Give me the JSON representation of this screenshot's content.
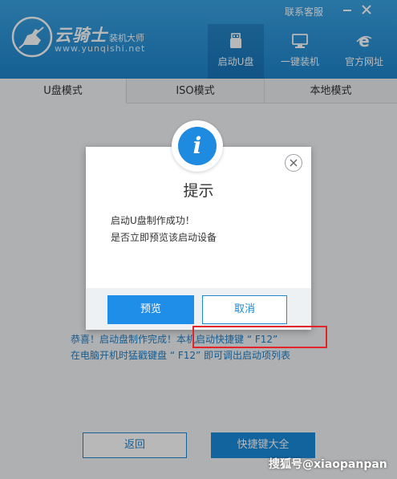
{
  "header": {
    "brand_name": "云骑士",
    "brand_sub": "装机大师",
    "brand_url": "www.yunqishi.net",
    "top_link": "联系客服",
    "nav": [
      {
        "label": "启动U盘",
        "icon": "usb-drive-icon"
      },
      {
        "label": "一键装机",
        "icon": "monitor-icon"
      },
      {
        "label": "官方网址",
        "icon": "browser-e-icon"
      }
    ]
  },
  "tabs": [
    {
      "label": "U盘模式"
    },
    {
      "label": "ISO模式"
    },
    {
      "label": "本地模式"
    }
  ],
  "main": {
    "line1_prefix": "恭喜！启动盘制作完成！",
    "line1_hotkey": "本机启动快捷键 “ F12”",
    "line2": "在电脑开机时猛戳键盘 “ F12” 即可调出启动项列表",
    "back_label": "返回",
    "hotkeys_label": "快捷键大全"
  },
  "dialog": {
    "info_glyph": "i",
    "title": "提示",
    "message_line1": "启动U盘制作成功！",
    "message_line2": "是否立即预览该启动设备",
    "preview_label": "预览",
    "cancel_label": "取消"
  },
  "watermark": "搜狐号@xiaopanpan",
  "colors": {
    "header_blue": "#1e85cc",
    "accent_blue": "#1f8ee8",
    "highlight_red": "#e3242b"
  }
}
